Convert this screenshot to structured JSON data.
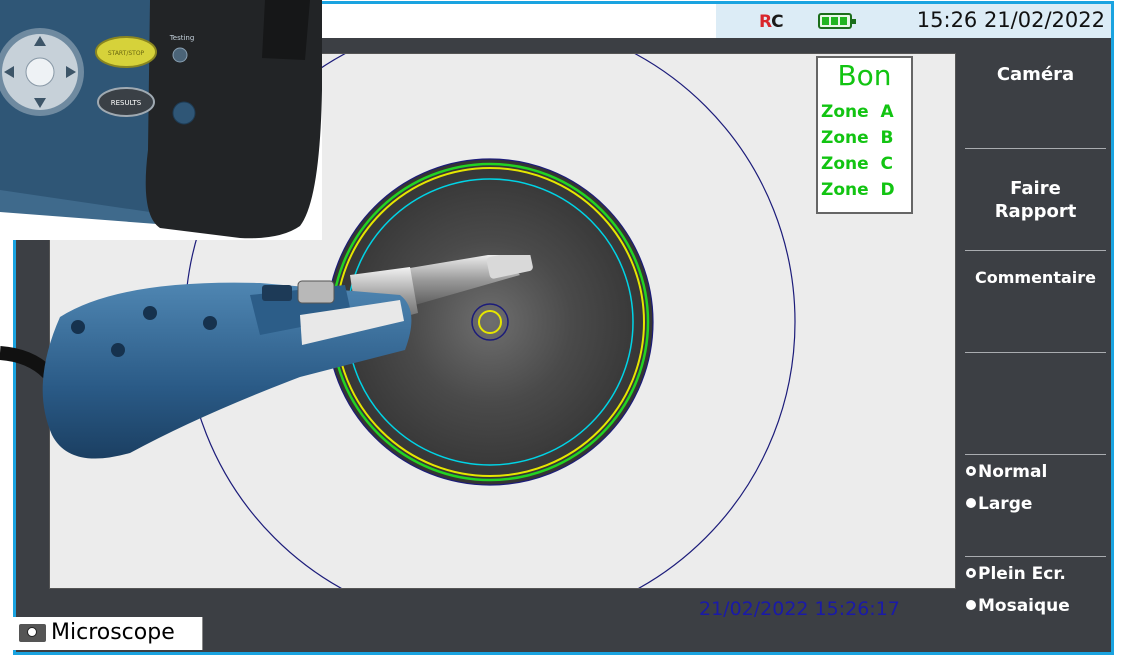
{
  "status_bar": {
    "clock": "15:26 21/02/2022",
    "logo_left": "R",
    "logo_right": "C"
  },
  "result": {
    "status": "Bon",
    "zones": [
      "Zone  A",
      "Zone  B",
      "Zone  C",
      "Zone  D"
    ]
  },
  "capture_timestamp": "21/02/2022 15:26:17",
  "sidebar": {
    "camera": "Caméra",
    "report_line1": "Faire",
    "report_line2": "Rapport",
    "comment": "Commentaire",
    "view_options": [
      {
        "label": "Normal",
        "selected": true
      },
      {
        "label": "Large",
        "selected": false
      }
    ],
    "display_options": [
      {
        "label": "Plein Ecr.",
        "selected": true
      },
      {
        "label": "Mosaique",
        "selected": false
      }
    ]
  },
  "tab": {
    "label": "Microscope",
    "icon": "camera-icon"
  },
  "device_overlay": {
    "button_start": "START/STOP",
    "button_results": "RESULTS",
    "led_label": "Testing"
  },
  "colors": {
    "frame_border": "#1aa3e0",
    "panel": "#3c3f44",
    "pass_green": "#12c412",
    "timestamp_blue": "#1a1aa8"
  }
}
